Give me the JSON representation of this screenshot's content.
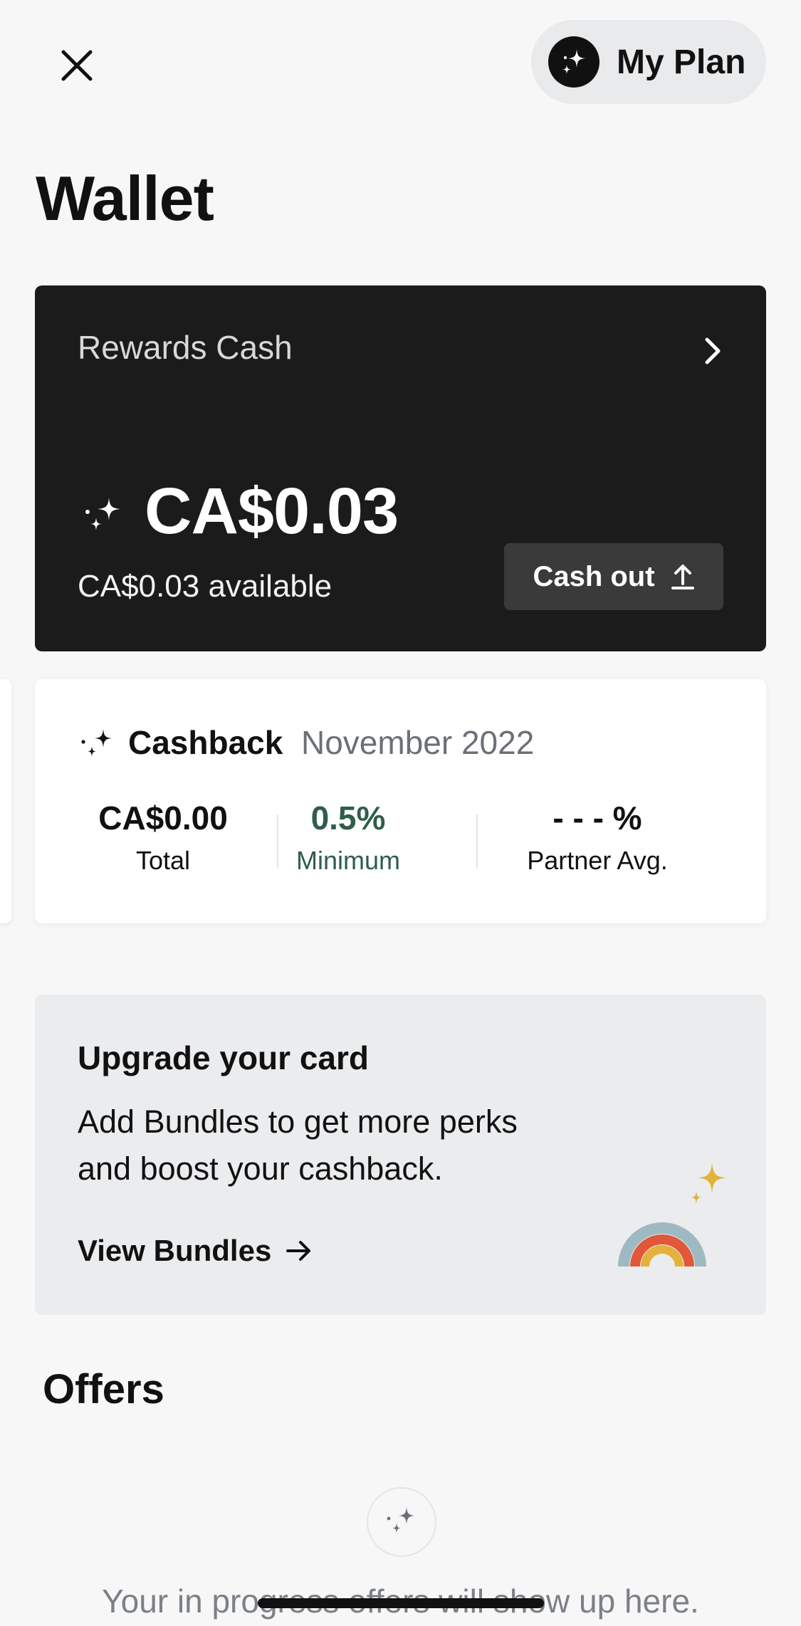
{
  "header": {
    "close_icon": "close-icon",
    "plan_label": "My Plan",
    "plan_icon": "sparkles-icon"
  },
  "page_title": "Wallet",
  "rewards": {
    "label": "Rewards Cash",
    "amount": "CA$0.03",
    "available": "CA$0.03 available",
    "cash_out_label": "Cash out"
  },
  "cashback": {
    "title": "Cashback",
    "month": "November 2022",
    "stats": [
      {
        "value": "CA$0.00",
        "label": "Total"
      },
      {
        "value": "0.5%",
        "label": "Minimum"
      },
      {
        "value": "- - - %",
        "label": "Partner Avg."
      }
    ],
    "minimum_color": "#2f5e4a"
  },
  "upgrade": {
    "title": "Upgrade your card",
    "description": "Add Bundles to get more perks and boost your cashback.",
    "link_label": "View Bundles"
  },
  "offers": {
    "title": "Offers",
    "empty_text": "Your in progress offers will show up here."
  },
  "colors": {
    "background": "#f7f7f8",
    "card_dark": "#1b1b1b",
    "accent_gold": "#e4b23a"
  }
}
